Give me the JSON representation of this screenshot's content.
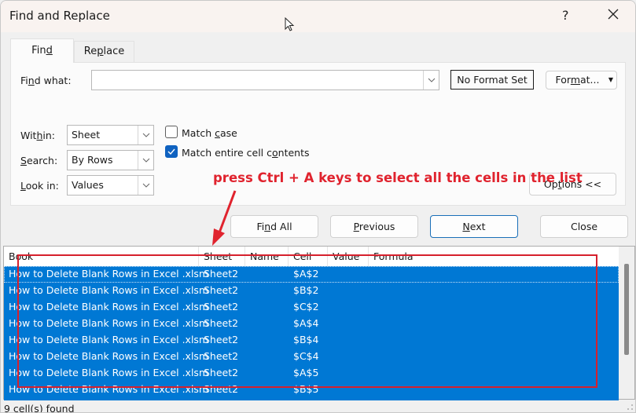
{
  "window": {
    "title": "Find and Replace",
    "help_label": "?",
    "close_icon": "close-icon"
  },
  "tabs": [
    {
      "label_pre": "Fin",
      "label_ul": "d",
      "label_post": "",
      "active": true
    },
    {
      "label_pre": "Re",
      "label_ul": "p",
      "label_post": "lace",
      "active": false
    }
  ],
  "find": {
    "label_pre": "Fi",
    "label_ul": "n",
    "label_post": "d what:",
    "value": "",
    "placeholder": "",
    "format_preview": "No Format Set",
    "format_button_pre": "For",
    "format_button_ul": "m",
    "format_button_post": "at..."
  },
  "options": {
    "within": {
      "label_pre": "Wit",
      "label_ul": "h",
      "label_post": "in:",
      "value": "Sheet"
    },
    "search": {
      "label_pre": "",
      "label_ul": "S",
      "label_post": "earch:",
      "value": "By Rows"
    },
    "look_in": {
      "label_pre": "",
      "label_ul": "L",
      "label_post": "ook in:",
      "value": "Values"
    },
    "match_case": {
      "label_pre": "Match ",
      "label_ul": "c",
      "label_post": "ase",
      "checked": false
    },
    "match_entire": {
      "label_pre": "Match entire cell c",
      "label_ul": "o",
      "label_post": "ntents",
      "checked": true
    },
    "options_button_pre": "Op",
    "options_button_ul": "t",
    "options_button_post": "ions <<"
  },
  "buttons": {
    "find_all_pre": "Fi",
    "find_all_ul": "n",
    "find_all_post": "d All",
    "previous_pre": "",
    "previous_ul": "P",
    "previous_post": "revious",
    "next_pre": "",
    "next_ul": "N",
    "next_post": "ext",
    "close": "Close"
  },
  "annotation": {
    "text": "press Ctrl + A keys to select all the cells in the list",
    "color": "#e0232e"
  },
  "results": {
    "columns": [
      "Book",
      "Sheet",
      "Name",
      "Cell",
      "Value",
      "Formula"
    ],
    "rows": [
      {
        "book": "How to Delete Blank Rows in Excel .xlsm",
        "sheet": "Sheet2",
        "name": "",
        "cell": "$A$2",
        "value": "",
        "formula": ""
      },
      {
        "book": "How to Delete Blank Rows in Excel .xlsm",
        "sheet": "Sheet2",
        "name": "",
        "cell": "$B$2",
        "value": "",
        "formula": ""
      },
      {
        "book": "How to Delete Blank Rows in Excel .xlsm",
        "sheet": "Sheet2",
        "name": "",
        "cell": "$C$2",
        "value": "",
        "formula": ""
      },
      {
        "book": "How to Delete Blank Rows in Excel .xlsm",
        "sheet": "Sheet2",
        "name": "",
        "cell": "$A$4",
        "value": "",
        "formula": ""
      },
      {
        "book": "How to Delete Blank Rows in Excel .xlsm",
        "sheet": "Sheet2",
        "name": "",
        "cell": "$B$4",
        "value": "",
        "formula": ""
      },
      {
        "book": "How to Delete Blank Rows in Excel .xlsm",
        "sheet": "Sheet2",
        "name": "",
        "cell": "$C$4",
        "value": "",
        "formula": ""
      },
      {
        "book": "How to Delete Blank Rows in Excel .xlsm",
        "sheet": "Sheet2",
        "name": "",
        "cell": "$A$5",
        "value": "",
        "formula": ""
      },
      {
        "book": "How to Delete Blank Rows in Excel .xlsm",
        "sheet": "Sheet2",
        "name": "",
        "cell": "$B$5",
        "value": "",
        "formula": ""
      }
    ],
    "selection_color": "#0078d4"
  },
  "status": {
    "text": "9 cell(s) found"
  }
}
